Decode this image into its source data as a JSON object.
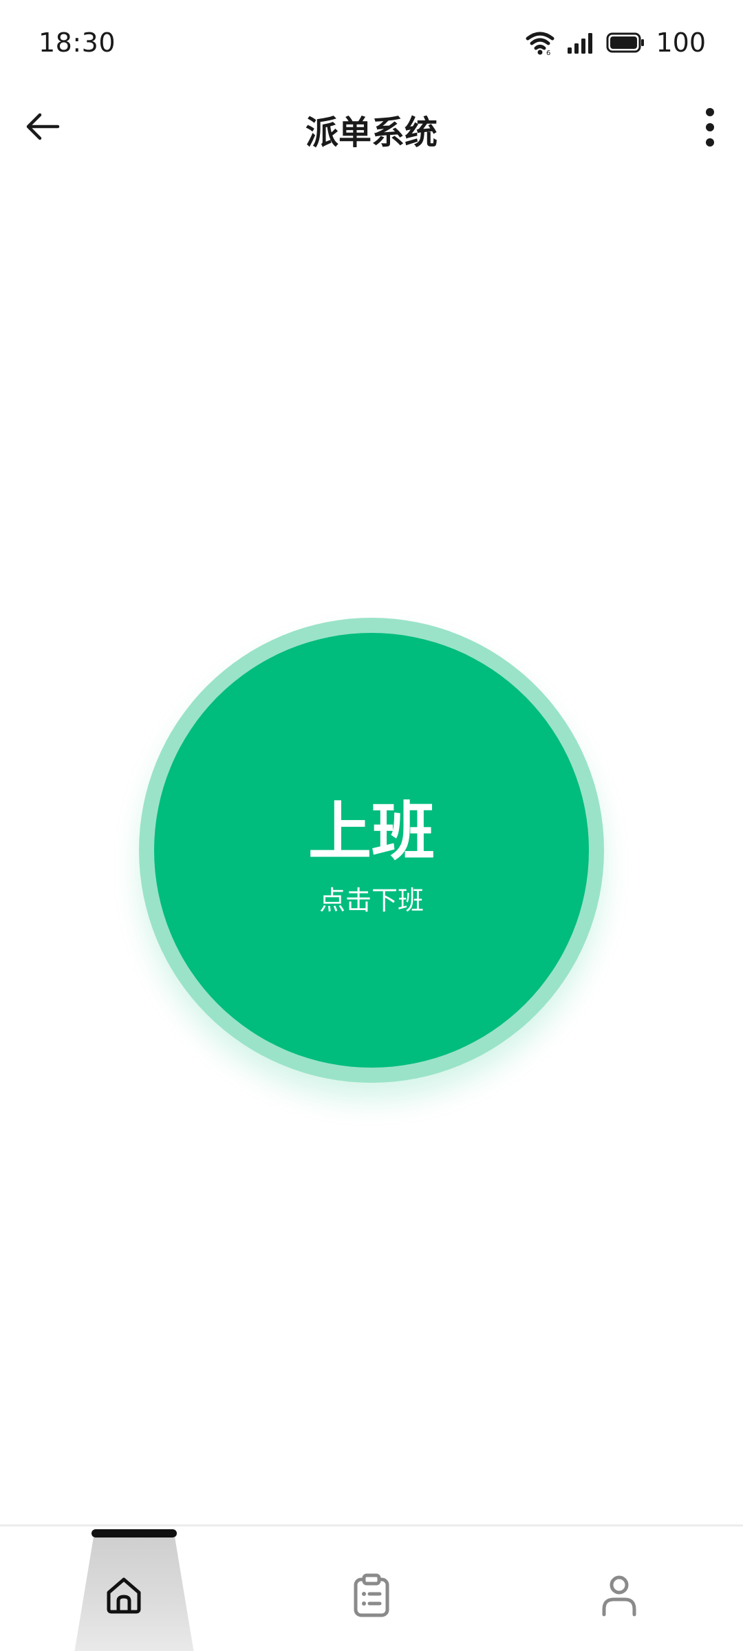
{
  "status_bar": {
    "time": "18:30",
    "battery": "100",
    "icons": [
      "wifi-icon",
      "signal-icon",
      "battery-icon"
    ]
  },
  "app_bar": {
    "title": "派单系统",
    "back_icon": "arrow-left-icon",
    "more_icon": "more-vertical-icon"
  },
  "clock_button": {
    "status": "上班",
    "hint": "点击下班",
    "colors": {
      "fill": "#00bc7d",
      "ring": "#9ae3c8",
      "text": "#ffffff"
    }
  },
  "bottom_nav": {
    "items": [
      {
        "id": "home",
        "icon": "home-icon",
        "active": true
      },
      {
        "id": "orders",
        "icon": "clipboard-list-icon",
        "active": false
      },
      {
        "id": "profile",
        "icon": "user-icon",
        "active": false
      }
    ]
  }
}
